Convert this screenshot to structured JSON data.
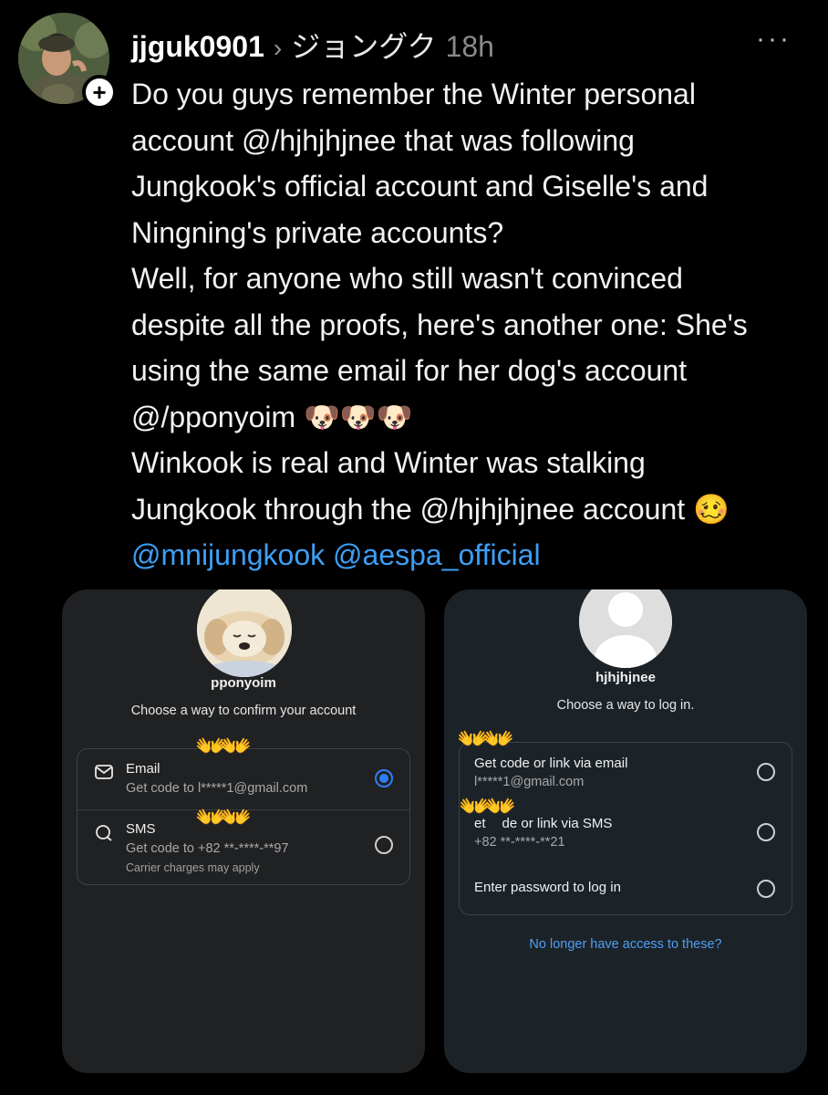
{
  "post": {
    "username": "jjguk0901",
    "chevron": "›",
    "display_name": "ジョングク",
    "time": "18h",
    "more": "···",
    "follow_badge": "+",
    "lines": [
      "Do you guys remember the Winter personal",
      "account @/hjhjhjnee that was following",
      "Jungkook's official account and Giselle's and",
      "Ningning's private accounts?",
      "Well, for anyone who still wasn't convinced",
      "despite all the proofs, here's another one: She's",
      "using the same email for her dog's account",
      "Winkook is real and Winter was stalking"
    ],
    "line_pponyoim": "@/pponyoim",
    "dog_emojis": "🐶🐶🐶",
    "line_last": "Jungkook through the @/hjhjhjnee account",
    "woozy_emoji": "🥴",
    "mentions": [
      "@mnijungkook",
      "@aespa_official"
    ]
  },
  "left_screenshot": {
    "account_name": "pponyoim",
    "subtitle": "Choose a way to confirm your account",
    "hands_emoji": "👐",
    "options": [
      {
        "title": "Email",
        "detail": "Get code to l*****1@gmail.com",
        "icon": "envelope-icon",
        "selected": true
      },
      {
        "title": "SMS",
        "detail": "Get code to +82 **-****-**97",
        "note": "Carrier charges may apply",
        "icon": "chat-bubble-icon",
        "selected": false
      }
    ]
  },
  "right_screenshot": {
    "account_name": "hjhjhjnee",
    "subtitle": "Choose a way to log in.",
    "hands_emoji": "👐",
    "options": [
      {
        "title": "Get code or link via email",
        "detail": "l*****1@gmail.com",
        "selected": false
      },
      {
        "title": "Get code or link via SMS",
        "title_visible": "de or link via SMS",
        "title_partial": "et",
        "detail": "+82 **-****-**21",
        "selected": false
      },
      {
        "title": "Enter password to log in",
        "selected": false
      }
    ],
    "footer_link": "No longer have access to these?"
  },
  "colors": {
    "background": "#000000",
    "mention": "#3d9ff5",
    "selected_radio": "#2d7ff9",
    "link": "#4f9ef5"
  }
}
